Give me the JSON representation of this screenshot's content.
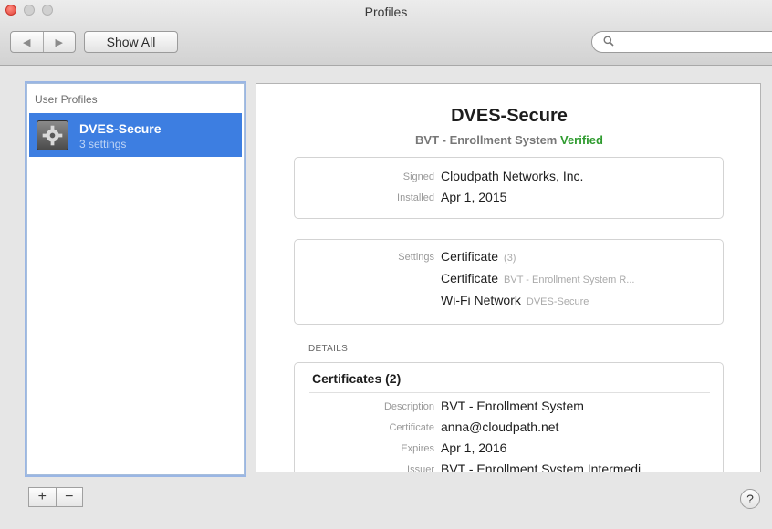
{
  "window": {
    "title": "Profiles"
  },
  "toolbar": {
    "back_glyph": "◀",
    "forward_glyph": "▶",
    "show_all_label": "Show All",
    "search_placeholder": ""
  },
  "sidebar": {
    "header": "User Profiles",
    "profiles": [
      {
        "name": "DVES-Secure",
        "subtitle": "3 settings",
        "icon": "profile-gear-icon",
        "selected": true
      }
    ]
  },
  "detail": {
    "title": "DVES-Secure",
    "subtitle_prefix": "BVT - Enrollment System",
    "subtitle_status": "Verified",
    "signed_label": "Signed",
    "signed_value": "Cloudpath Networks, Inc.",
    "installed_label": "Installed",
    "installed_value": "Apr 1, 2015",
    "settings_label": "Settings",
    "settings": [
      {
        "name": "Certificate",
        "detail": "(3)"
      },
      {
        "name": "Certificate",
        "detail": "BVT - Enrollment System R..."
      },
      {
        "name": "Wi-Fi Network",
        "detail": "DVES-Secure"
      }
    ],
    "details_header": "DETAILS",
    "certificates_header": "Certificates (2)",
    "cert_fields": [
      {
        "label": "Description",
        "value": "BVT - Enrollment System"
      },
      {
        "label": "Certificate",
        "value": "anna@cloudpath.net"
      },
      {
        "label": "Expires",
        "value": "Apr 1, 2016"
      },
      {
        "label": "Issuer",
        "value": "BVT - Enrollment System Intermedi..."
      }
    ]
  },
  "footer": {
    "add_label": "+",
    "remove_label": "−",
    "help_label": "?"
  },
  "colors": {
    "selection": "#3d7ee1",
    "verified": "#2f9b2f",
    "close_button": "#e0443a"
  }
}
